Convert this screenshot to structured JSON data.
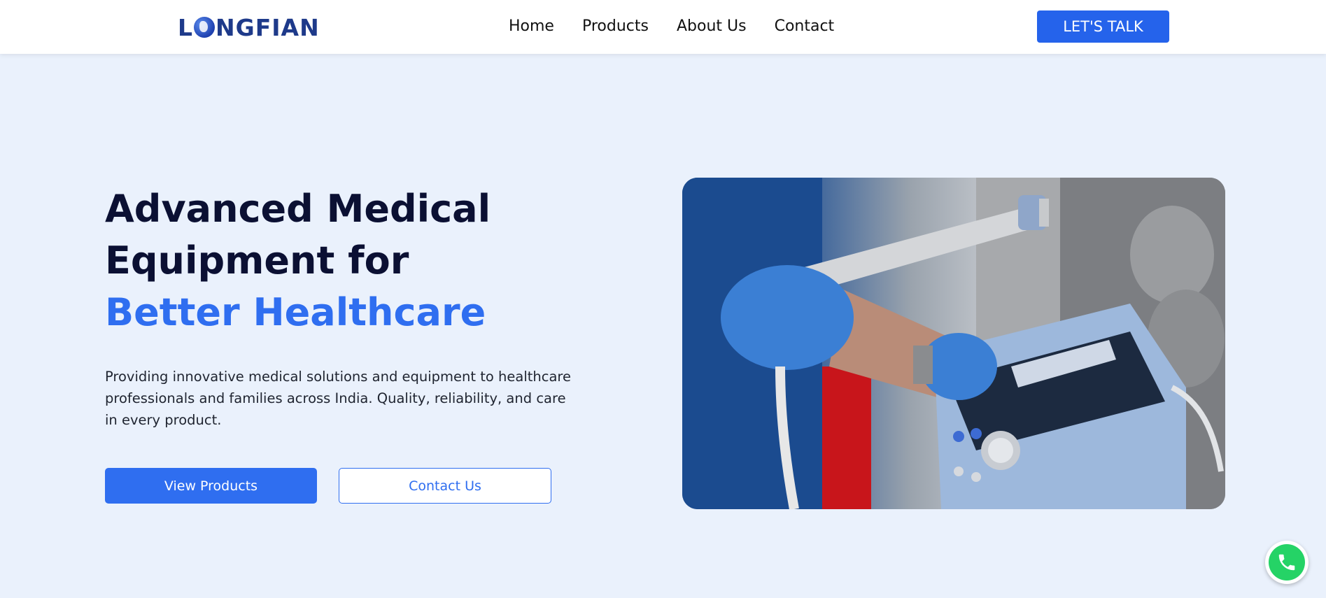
{
  "header": {
    "logo_text_prefix": "L",
    "logo_text_suffix": "NGFIAN",
    "nav": [
      {
        "label": "Home"
      },
      {
        "label": "Products"
      },
      {
        "label": "About Us"
      },
      {
        "label": "Contact"
      }
    ],
    "cta_label": "LET'S TALK"
  },
  "hero": {
    "title_line1": "Advanced Medical",
    "title_line2": "Equipment for",
    "title_accent": "Better Healthcare",
    "description": "Providing innovative medical solutions and equipment to healthcare professionals and families across India. Quality, reliability, and care in every product.",
    "primary_button": "View Products",
    "secondary_button": "Contact Us",
    "image_icon": "medical-device-photo"
  },
  "floating": {
    "whatsapp_icon": "whatsapp-icon"
  },
  "colors": {
    "brand_blue": "#2f6ef0",
    "header_cta": "#2563eb",
    "heading_dark": "#0b1033",
    "page_bg": "#eaf1fc",
    "whatsapp_green": "#25d366"
  }
}
